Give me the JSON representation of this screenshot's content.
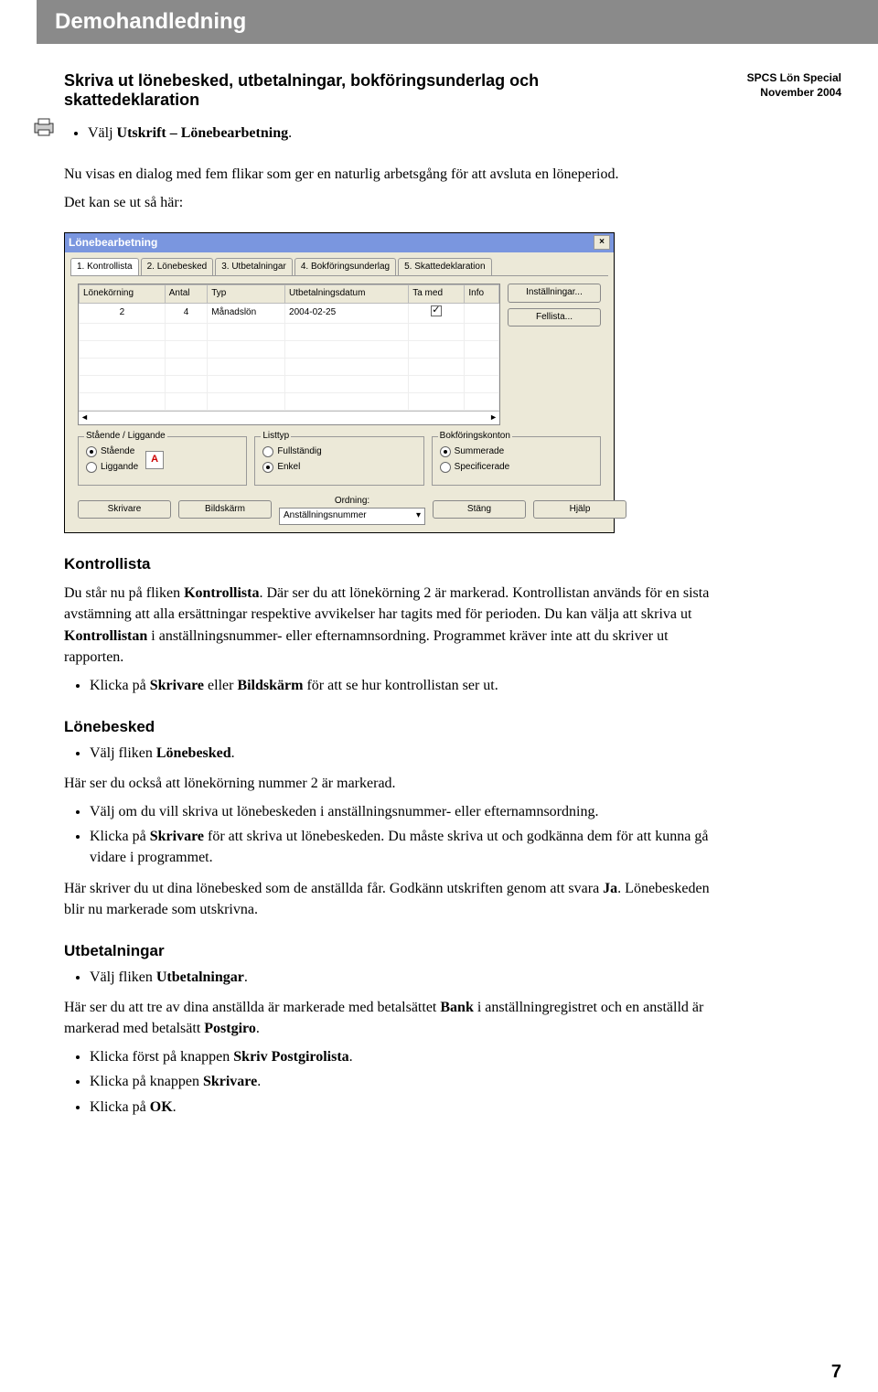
{
  "banner": "Demohandledning",
  "meta": {
    "line1": "SPCS Lön Special",
    "line2": "November 2004"
  },
  "section_title": "Skriva ut lönebesked, utbetalningar, bokföringsunderlag och skattedeklaration",
  "intro": {
    "bullet1_prefix": "Välj ",
    "bullet1_bold": "Utskrift – Lönebearbetning",
    "bullet1_suffix": ".",
    "para1": "Nu visas en dialog med fem flikar som ger en naturlig arbetsgång för att avsluta en löneperiod.",
    "para2": "Det kan se ut så här:"
  },
  "dialog": {
    "title": "Lönebearbetning",
    "tabs": [
      "1. Kontrollista",
      "2. Lönebesked",
      "3. Utbetalningar",
      "4. Bokföringsunderlag",
      "5. Skattedeklaration"
    ],
    "cols": [
      "Lönekörning",
      "Antal",
      "Typ",
      "Utbetalningsdatum",
      "Ta med",
      "Info"
    ],
    "row": {
      "lonekorning": "2",
      "antal": "4",
      "typ": "Månadslön",
      "datum": "2004-02-25"
    },
    "btn_installningar": "Inställningar...",
    "btn_fellista": "Fellista...",
    "group1": {
      "title": "Stående / Liggande",
      "opt1": "Stående",
      "opt2": "Liggande"
    },
    "group2": {
      "title": "Listtyp",
      "opt1": "Fullständig",
      "opt2": "Enkel"
    },
    "group3": {
      "title": "Bokföringskonton",
      "opt1": "Summerade",
      "opt2": "Specificerade"
    },
    "ordning_label": "Ordning:",
    "ordning_value": "Anställningsnummer",
    "btn_skrivare": "Skrivare",
    "btn_bildskarm": "Bildskärm",
    "btn_stang": "Stäng",
    "btn_hjalp": "Hjälp"
  },
  "kontrollista": {
    "title": "Kontrollista",
    "p_1a": "Du står nu på fliken ",
    "p_1b": "Kontrollista",
    "p_1c": ". Där ser du att lönekörning 2 är markerad. Kontrollistan används för en sista avstämning att alla ersättningar respektive avvikelser har tagits med för perioden. Du kan välja att skriva ut ",
    "p_1d": "Kontrollistan",
    "p_1e": " i anställningsnummer- eller efternamnsordning. Programmet kräver inte att du skriver ut rapporten.",
    "b1a": "Klicka på ",
    "b1b": "Skrivare",
    "b1c": " eller ",
    "b1d": "Bildskärm",
    "b1e": " för att se hur kontrollistan ser ut."
  },
  "lonebesked": {
    "title": "Lönebesked",
    "b1a": "Välj fliken ",
    "b1b": "Lönebesked",
    "b1c": ".",
    "p1": "Här ser du också att lönekörning nummer 2 är markerad.",
    "b2": "Välj om du vill skriva ut lönebeskeden i anställningsnummer- eller efternamnsordning.",
    "b3a": "Klicka på ",
    "b3b": "Skrivare",
    "b3c": " för att skriva ut lönebeskeden. Du måste skriva ut och godkänna dem för att kunna gå vidare i programmet.",
    "p2a": "Här skriver du ut dina lönebesked som de anställda får. Godkänn utskriften genom att svara ",
    "p2b": "Ja",
    "p2c": ". Lönebeskeden blir nu markerade som utskrivna."
  },
  "utbetalningar": {
    "title": "Utbetalningar",
    "b1a": "Välj fliken ",
    "b1b": "Utbetalningar",
    "b1c": ".",
    "p1a": "Här ser du att tre av dina anställda är markerade med betalsättet ",
    "p1b": "Bank",
    "p1c": " i anställningregistret och en anställd är markerad med betalsätt ",
    "p1d": "Postgiro",
    "p1e": ".",
    "b2a": "Klicka först på knappen ",
    "b2b": "Skriv Postgirolista",
    "b2c": ".",
    "b3a": "Klicka på knappen ",
    "b3b": "Skrivare",
    "b3c": ".",
    "b4a": "Klicka på ",
    "b4b": "OK",
    "b4c": "."
  },
  "page_number": "7"
}
